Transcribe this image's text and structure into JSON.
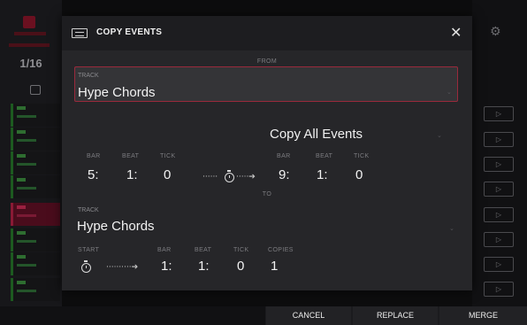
{
  "background": {
    "quantize": "1/16",
    "colors": {
      "track_green": "#2e6d30",
      "track_selected": "#8a1a35"
    }
  },
  "dialog": {
    "title": "COPY EVENTS",
    "from_label": "FROM",
    "to_label": "TO",
    "from": {
      "track_label": "TRACK",
      "track_value": "Hype Chords",
      "mode": "Copy All Events",
      "start": {
        "bar_label": "BAR",
        "beat_label": "BEAT",
        "tick_label": "TICK",
        "bar": "5:",
        "beat": "1:",
        "tick": "0"
      },
      "end": {
        "bar_label": "BAR",
        "beat_label": "BEAT",
        "tick_label": "TICK",
        "bar": "9:",
        "beat": "1:",
        "tick": "0"
      }
    },
    "to": {
      "track_label": "TRACK",
      "track_value": "Hype Chords",
      "start_label": "START",
      "bar_label": "BAR",
      "beat_label": "BEAT",
      "tick_label": "TICK",
      "copies_label": "COPIES",
      "bar": "1:",
      "beat": "1:",
      "tick": "0",
      "copies": "1"
    },
    "accent_color": "#9a2a3c"
  },
  "footer": {
    "cancel": "CANCEL",
    "replace": "REPLACE",
    "merge": "MERGE"
  },
  "icons": {
    "close": "close-icon",
    "copy_events": "copy-events-icon",
    "stopwatch": "stopwatch-icon",
    "gear": "gear-icon",
    "play": "play-icon"
  }
}
